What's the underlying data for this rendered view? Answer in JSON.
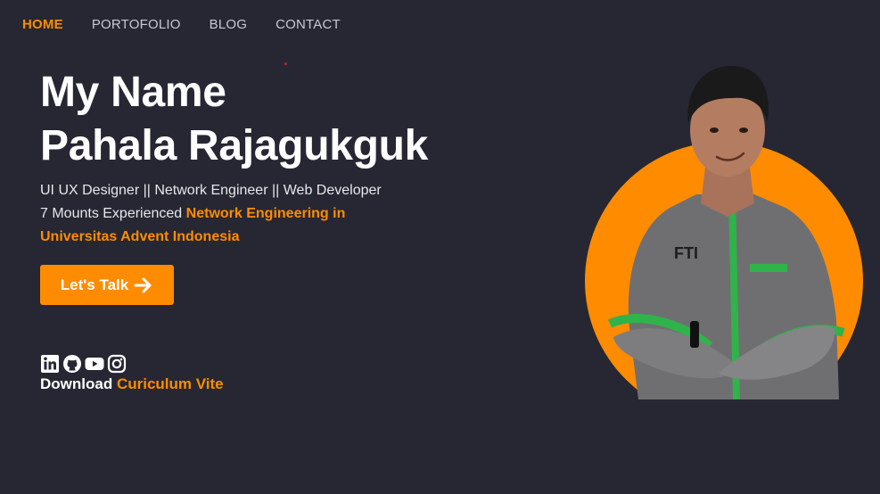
{
  "nav": {
    "items": [
      {
        "label": "HOME",
        "active": true
      },
      {
        "label": "PORTOFOLIO",
        "active": false
      },
      {
        "label": "BLOG",
        "active": false
      },
      {
        "label": "CONTACT",
        "active": false
      }
    ]
  },
  "hero": {
    "title_line1": "My Name",
    "title_line2": "Pahala Rajagukguk",
    "roles": "UI UX Designer || Network Engineer || Web Developer",
    "experience_prefix": "7 Mounts Experienced ",
    "experience_highlight": "Network Engineering in Universitas Advent Indonesia",
    "cta_label": "Let's Talk"
  },
  "socials": [
    {
      "icon": "linkedin-icon"
    },
    {
      "icon": "github-icon"
    },
    {
      "icon": "youtube-icon"
    },
    {
      "icon": "instagram-icon"
    }
  ],
  "download": {
    "prefix": "Download ",
    "link": "Curiculum Vite"
  },
  "colors": {
    "background": "#262733",
    "accent": "#ff8c00",
    "text": "#ffffff",
    "nav_text": "#c9c9cf"
  }
}
